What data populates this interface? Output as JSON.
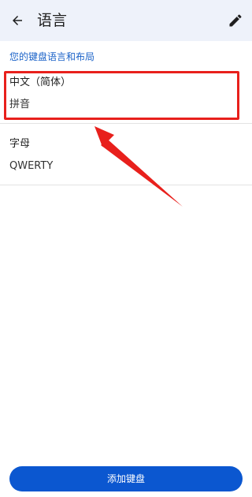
{
  "header": {
    "title": "语言",
    "back_icon": "arrow-left-icon",
    "edit_icon": "pencil-icon"
  },
  "section": {
    "title": "您的键盘语言和布局"
  },
  "languages": [
    {
      "name": "中文（简体）",
      "layout": "拼音"
    },
    {
      "name": "字母",
      "layout": "QWERTY"
    }
  ],
  "actions": {
    "add_keyboard_label": "添加键盘"
  },
  "colors": {
    "accent": "#0b57d0",
    "section_header": "#1a62c8",
    "topbar_bg": "#eef2fa",
    "annotation_red": "#e8201c"
  }
}
